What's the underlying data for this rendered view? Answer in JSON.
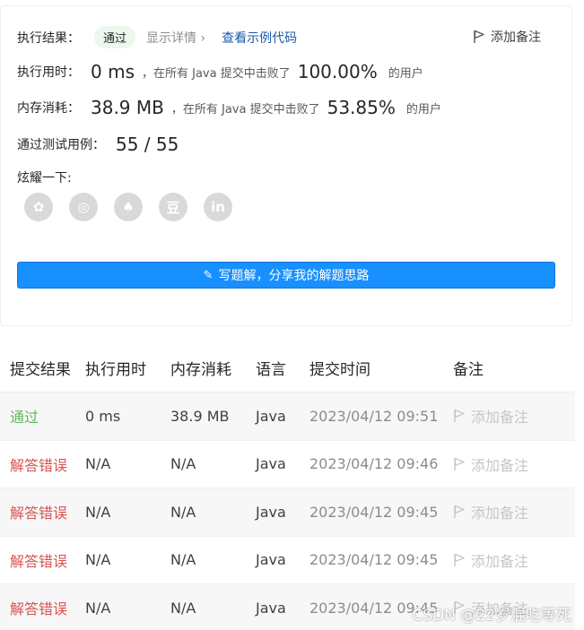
{
  "result": {
    "label": "执行结果：",
    "status": "通过",
    "details": "显示详情 ›",
    "example_code": "查看示例代码",
    "add_note": "添加备注"
  },
  "runtime": {
    "label": "执行用时：",
    "value": "0 ms",
    "mid": "，在所有 Java 提交中击败了",
    "percent": "100.00%",
    "suffix": "的用户"
  },
  "memory": {
    "label": "内存消耗：",
    "value": "38.9 MB",
    "mid": "，在所有 Java 提交中击败了",
    "percent": "53.85%",
    "suffix": "的用户"
  },
  "tests": {
    "label": "通过测试用例：",
    "value": "55 / 55"
  },
  "share": {
    "label": "炫耀一下:",
    "icons": [
      "wechat-icon",
      "weibo-icon",
      "qq-icon",
      "douban-icon",
      "linkedin-icon"
    ],
    "glyphs": [
      "✿",
      "◎",
      "♠",
      "豆",
      "in"
    ]
  },
  "solution_button": "写题解，分享我的解题思路",
  "table": {
    "headers": [
      "提交结果",
      "执行用时",
      "内存消耗",
      "语言",
      "提交时间",
      "备注"
    ],
    "rows": [
      {
        "status": "通过",
        "time": "0 ms",
        "memory": "38.9 MB",
        "lang": "Java",
        "submitted": "2023/04/12 09:51",
        "note": "添加备注"
      },
      {
        "status": "解答错误",
        "time": "N/A",
        "memory": "N/A",
        "lang": "Java",
        "submitted": "2023/04/12 09:46",
        "note": "添加备注"
      },
      {
        "status": "解答错误",
        "time": "N/A",
        "memory": "N/A",
        "lang": "Java",
        "submitted": "2023/04/12 09:45",
        "note": "添加备注"
      },
      {
        "status": "解答错误",
        "time": "N/A",
        "memory": "N/A",
        "lang": "Java",
        "submitted": "2023/04/12 09:45",
        "note": "添加备注"
      },
      {
        "status": "解答错误",
        "time": "N/A",
        "memory": "N/A",
        "lang": "Java",
        "submitted": "2023/04/12 09:45",
        "note": "添加备注"
      }
    ]
  },
  "watermark": "CSDN @22岁混吃等死",
  "colors": {
    "accent": "#1890ff",
    "pass": "#5cb85c",
    "fail": "#d9534f"
  }
}
